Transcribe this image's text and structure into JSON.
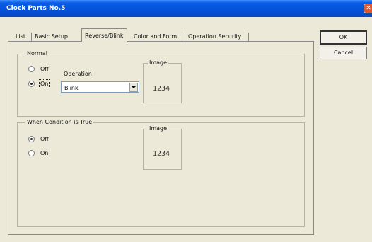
{
  "window": {
    "title": "Clock Parts No.5"
  },
  "tabs": [
    {
      "label": "List"
    },
    {
      "label": "Basic Setup"
    },
    {
      "label": "Reverse/Blink"
    },
    {
      "label": "Color and Form"
    },
    {
      "label": "Operation Security"
    }
  ],
  "normal": {
    "label": "Normal",
    "off_label": "Off",
    "on_label": "On",
    "selected": "On",
    "operation_label": "Operation",
    "operation_value": "Blink",
    "image_label": "Image",
    "image_value": "1234"
  },
  "condition": {
    "label": "When Condition is True",
    "off_label": "Off",
    "on_label": "On",
    "selected": "Off",
    "image_label": "Image",
    "image_value": "1234"
  },
  "buttons": {
    "ok": "OK",
    "cancel": "Cancel"
  }
}
